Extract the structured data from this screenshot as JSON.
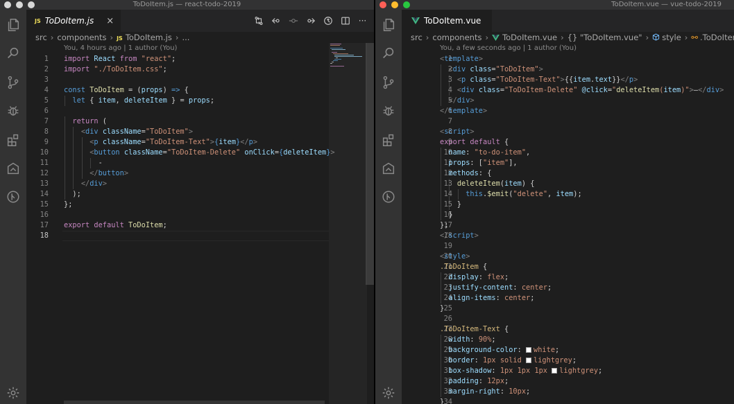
{
  "left": {
    "window_title": "ToDoItem.js — react-todo-2019",
    "tab": {
      "file_icon": "JS",
      "label": "ToDoItem.js",
      "close_glyph": "×"
    },
    "toolbar": {
      "more_glyph": "···"
    },
    "breadcrumb": {
      "folder1": "src",
      "folder2": "components",
      "file_icon": "JS",
      "file": "ToDoItem.js",
      "symbol": "..."
    },
    "blame": "You, 4 hours ago | 1 author (You)",
    "active_line": 18,
    "code": [
      [
        [
          "kw",
          "import"
        ],
        [
          "t",
          " "
        ],
        [
          "vr",
          "React"
        ],
        [
          "t",
          " "
        ],
        [
          "kw",
          "from"
        ],
        [
          "t",
          " "
        ],
        [
          "str",
          "\"react\""
        ],
        [
          "t",
          ";"
        ]
      ],
      [
        [
          "kw",
          "import"
        ],
        [
          "t",
          " "
        ],
        [
          "str",
          "\"./ToDoItem.css\""
        ],
        [
          "t",
          ";"
        ]
      ],
      [],
      [
        [
          "kb",
          "const"
        ],
        [
          "t",
          " "
        ],
        [
          "fn",
          "ToDoItem"
        ],
        [
          "t",
          " = ("
        ],
        [
          "vr",
          "props"
        ],
        [
          "t",
          ") "
        ],
        [
          "kb",
          "=>"
        ],
        [
          "t",
          " {"
        ]
      ],
      [
        [
          "t",
          "  "
        ],
        [
          "kb",
          "let"
        ],
        [
          "t",
          " { "
        ],
        [
          "vr",
          "item"
        ],
        [
          "t",
          ", "
        ],
        [
          "vr",
          "deleteItem"
        ],
        [
          "t",
          " } = "
        ],
        [
          "vr",
          "props"
        ],
        [
          "t",
          ";"
        ]
      ],
      [],
      [
        [
          "t",
          "  "
        ],
        [
          "kw",
          "return"
        ],
        [
          "t",
          " ("
        ]
      ],
      [
        [
          "t",
          "    "
        ],
        [
          "tg",
          "<"
        ],
        [
          "tgn",
          "div"
        ],
        [
          "t",
          " "
        ],
        [
          "at",
          "className"
        ],
        [
          "t",
          "="
        ],
        [
          "str",
          "\"ToDoItem\""
        ],
        [
          "tg",
          ">"
        ]
      ],
      [
        [
          "t",
          "      "
        ],
        [
          "tg",
          "<"
        ],
        [
          "tgn",
          "p"
        ],
        [
          "t",
          " "
        ],
        [
          "at",
          "className"
        ],
        [
          "t",
          "="
        ],
        [
          "str",
          "\"ToDoItem-Text\""
        ],
        [
          "tg",
          ">"
        ],
        [
          "kb",
          "{"
        ],
        [
          "vr",
          "item"
        ],
        [
          "kb",
          "}"
        ],
        [
          "tg",
          "</"
        ],
        [
          "tgn",
          "p"
        ],
        [
          "tg",
          ">"
        ]
      ],
      [
        [
          "t",
          "      "
        ],
        [
          "tg",
          "<"
        ],
        [
          "tgn",
          "button"
        ],
        [
          "t",
          " "
        ],
        [
          "at",
          "className"
        ],
        [
          "t",
          "="
        ],
        [
          "str",
          "\"ToDoItem-Delete\""
        ],
        [
          "t",
          " "
        ],
        [
          "at",
          "onClick"
        ],
        [
          "t",
          "="
        ],
        [
          "kb",
          "{"
        ],
        [
          "vr",
          "deleteItem"
        ],
        [
          "kb",
          "}"
        ],
        [
          "tg",
          ">"
        ]
      ],
      [
        [
          "t",
          "        -"
        ]
      ],
      [
        [
          "t",
          "      "
        ],
        [
          "tg",
          "</"
        ],
        [
          "tgn",
          "button"
        ],
        [
          "tg",
          ">"
        ]
      ],
      [
        [
          "t",
          "    "
        ],
        [
          "tg",
          "</"
        ],
        [
          "tgn",
          "div"
        ],
        [
          "tg",
          ">"
        ]
      ],
      [
        [
          "t",
          "  );"
        ]
      ],
      [
        [
          "t",
          "};"
        ]
      ],
      [],
      [
        [
          "kw",
          "export"
        ],
        [
          "t",
          " "
        ],
        [
          "kw",
          "default"
        ],
        [
          "t",
          " "
        ],
        [
          "fn",
          "ToDoItem"
        ],
        [
          "t",
          ";"
        ]
      ],
      []
    ],
    "guides": [
      [],
      [],
      [],
      [],
      [
        1
      ],
      [],
      [
        1
      ],
      [
        1,
        2
      ],
      [
        1,
        2,
        3
      ],
      [
        1,
        2,
        3
      ],
      [
        1,
        2,
        3,
        4
      ],
      [
        1,
        2,
        3
      ],
      [
        1,
        2
      ],
      [
        1
      ],
      [],
      [],
      [],
      []
    ]
  },
  "right": {
    "window_title": "ToDoItem.vue — vue-todo-2019",
    "tab": {
      "label": "ToDoItem.vue"
    },
    "breadcrumb": {
      "folder1": "src",
      "folder2": "components",
      "file": "ToDoItem.vue",
      "braces": "{}",
      "symbol1": "\"ToDoItem.vue\"",
      "symbol2": "style",
      "symbol3": ".ToDoItem-Delete"
    },
    "blame": "You, a few seconds ago | 1 author (You)",
    "code": [
      [
        [
          "tg",
          "<"
        ],
        [
          "tgn",
          "template"
        ],
        [
          "tg",
          ">"
        ]
      ],
      [
        [
          "t",
          "  "
        ],
        [
          "tg",
          "<"
        ],
        [
          "tgn",
          "div"
        ],
        [
          "t",
          " "
        ],
        [
          "at",
          "class"
        ],
        [
          "t",
          "="
        ],
        [
          "str",
          "\"ToDoItem\""
        ],
        [
          "tg",
          ">"
        ]
      ],
      [
        [
          "t",
          "    "
        ],
        [
          "tg",
          "<"
        ],
        [
          "tgn",
          "p"
        ],
        [
          "t",
          " "
        ],
        [
          "at",
          "class"
        ],
        [
          "t",
          "="
        ],
        [
          "str",
          "\"ToDoItem-Text\""
        ],
        [
          "tg",
          ">"
        ],
        [
          "t",
          "{{"
        ],
        [
          "vr",
          "item"
        ],
        [
          "t",
          "."
        ],
        [
          "vr",
          "text"
        ],
        [
          "t",
          "}}"
        ],
        [
          "tg",
          "</"
        ],
        [
          "tgn",
          "p"
        ],
        [
          "tg",
          ">"
        ]
      ],
      [
        [
          "t",
          "    "
        ],
        [
          "tg",
          "<"
        ],
        [
          "tgn",
          "div"
        ],
        [
          "t",
          " "
        ],
        [
          "at",
          "class"
        ],
        [
          "t",
          "="
        ],
        [
          "str",
          "\"ToDoItem-Delete\""
        ],
        [
          "t",
          " "
        ],
        [
          "at",
          "@click"
        ],
        [
          "t",
          "="
        ],
        [
          "str",
          "\""
        ],
        [
          "fn",
          "deleteItem"
        ],
        [
          "str",
          "("
        ],
        [
          "vr",
          "item"
        ],
        [
          "str",
          ")\""
        ],
        [
          "tg",
          ">"
        ],
        [
          "t",
          "—"
        ],
        [
          "tg",
          "</"
        ],
        [
          "tgn",
          "div"
        ],
        [
          "tg",
          ">"
        ]
      ],
      [
        [
          "t",
          "  "
        ],
        [
          "tg",
          "</"
        ],
        [
          "tgn",
          "div"
        ],
        [
          "tg",
          ">"
        ]
      ],
      [
        [
          "tg",
          "</"
        ],
        [
          "tgn",
          "template"
        ],
        [
          "tg",
          ">"
        ]
      ],
      [],
      [
        [
          "tg",
          "<"
        ],
        [
          "tgn",
          "script"
        ],
        [
          "tg",
          ">"
        ]
      ],
      [
        [
          "kw",
          "export"
        ],
        [
          "t",
          " "
        ],
        [
          "kw",
          "default"
        ],
        [
          "t",
          " {"
        ]
      ],
      [
        [
          "t",
          "  "
        ],
        [
          "vr",
          "name"
        ],
        [
          "t",
          ": "
        ],
        [
          "str",
          "\"to-do-item\""
        ],
        [
          "t",
          ","
        ]
      ],
      [
        [
          "t",
          "  "
        ],
        [
          "vr",
          "props"
        ],
        [
          "t",
          ": ["
        ],
        [
          "str",
          "\"item\""
        ],
        [
          "t",
          "],"
        ]
      ],
      [
        [
          "t",
          "  "
        ],
        [
          "vr",
          "methods"
        ],
        [
          "t",
          ": {"
        ]
      ],
      [
        [
          "t",
          "    "
        ],
        [
          "fn",
          "deleteItem"
        ],
        [
          "t",
          "("
        ],
        [
          "vr",
          "item"
        ],
        [
          "t",
          ") {"
        ]
      ],
      [
        [
          "t",
          "      "
        ],
        [
          "kb",
          "this"
        ],
        [
          "t",
          "."
        ],
        [
          "fn",
          "$emit"
        ],
        [
          "t",
          "("
        ],
        [
          "str",
          "\"delete\""
        ],
        [
          "t",
          ", "
        ],
        [
          "vr",
          "item"
        ],
        [
          "t",
          ");"
        ]
      ],
      [
        [
          "t",
          "    }"
        ]
      ],
      [
        [
          "t",
          "  }"
        ]
      ],
      [
        [
          "t",
          "};"
        ]
      ],
      [
        [
          "tg",
          "</"
        ],
        [
          "tgn",
          "script"
        ],
        [
          "tg",
          ">"
        ]
      ],
      [],
      [
        [
          "tg",
          "<"
        ],
        [
          "tgn",
          "style"
        ],
        [
          "tg",
          ">"
        ]
      ],
      [
        [
          "cls",
          ".ToDoItem"
        ],
        [
          "t",
          " {"
        ]
      ],
      [
        [
          "t",
          "  "
        ],
        [
          "pp",
          "display"
        ],
        [
          "t",
          ": "
        ],
        [
          "vl",
          "flex"
        ],
        [
          "t",
          ";"
        ]
      ],
      [
        [
          "t",
          "  "
        ],
        [
          "pp",
          "justify-content"
        ],
        [
          "t",
          ": "
        ],
        [
          "vl",
          "center"
        ],
        [
          "t",
          ";"
        ]
      ],
      [
        [
          "t",
          "  "
        ],
        [
          "pp",
          "align-items"
        ],
        [
          "t",
          ": "
        ],
        [
          "vl",
          "center"
        ],
        [
          "t",
          ";"
        ]
      ],
      [
        [
          "t",
          "}"
        ]
      ],
      [],
      [
        [
          "cls",
          ".ToDoItem-Text"
        ],
        [
          "t",
          " {"
        ]
      ],
      [
        [
          "t",
          "  "
        ],
        [
          "pp",
          "width"
        ],
        [
          "t",
          ": "
        ],
        [
          "vl",
          "90%"
        ],
        [
          "t",
          ";"
        ]
      ],
      [
        [
          "t",
          "  "
        ],
        [
          "pp",
          "background-color"
        ],
        [
          "t",
          ": "
        ],
        [
          "sw",
          ""
        ],
        [
          "vl",
          "white"
        ],
        [
          "t",
          ";"
        ]
      ],
      [
        [
          "t",
          "  "
        ],
        [
          "pp",
          "border"
        ],
        [
          "t",
          ": "
        ],
        [
          "vl",
          "1px solid "
        ],
        [
          "sw",
          ""
        ],
        [
          "vl",
          "lightgrey"
        ],
        [
          "t",
          ";"
        ]
      ],
      [
        [
          "t",
          "  "
        ],
        [
          "pp",
          "box-shadow"
        ],
        [
          "t",
          ": "
        ],
        [
          "vl",
          "1px 1px 1px "
        ],
        [
          "sw",
          ""
        ],
        [
          "vl",
          "lightgrey"
        ],
        [
          "t",
          ";"
        ]
      ],
      [
        [
          "t",
          "  "
        ],
        [
          "pp",
          "padding"
        ],
        [
          "t",
          ": "
        ],
        [
          "vl",
          "12px"
        ],
        [
          "t",
          ";"
        ]
      ],
      [
        [
          "t",
          "  "
        ],
        [
          "pp",
          "margin-right"
        ],
        [
          "t",
          ": "
        ],
        [
          "vl",
          "10px"
        ],
        [
          "t",
          ";"
        ]
      ],
      [
        [
          "t",
          "}"
        ]
      ]
    ],
    "guides": [
      [],
      [
        1
      ],
      [
        1,
        2
      ],
      [
        1,
        2
      ],
      [
        1
      ],
      [],
      [],
      [],
      [],
      [
        1
      ],
      [
        1
      ],
      [
        1
      ],
      [
        1,
        2
      ],
      [
        1,
        2,
        3
      ],
      [
        1,
        2
      ],
      [
        1
      ],
      [],
      [],
      [],
      [],
      [],
      [
        1
      ],
      [
        1
      ],
      [
        1
      ],
      [],
      [],
      [],
      [
        1
      ],
      [
        1
      ],
      [
        1
      ],
      [
        1
      ],
      [
        1
      ],
      [
        1
      ],
      []
    ]
  }
}
